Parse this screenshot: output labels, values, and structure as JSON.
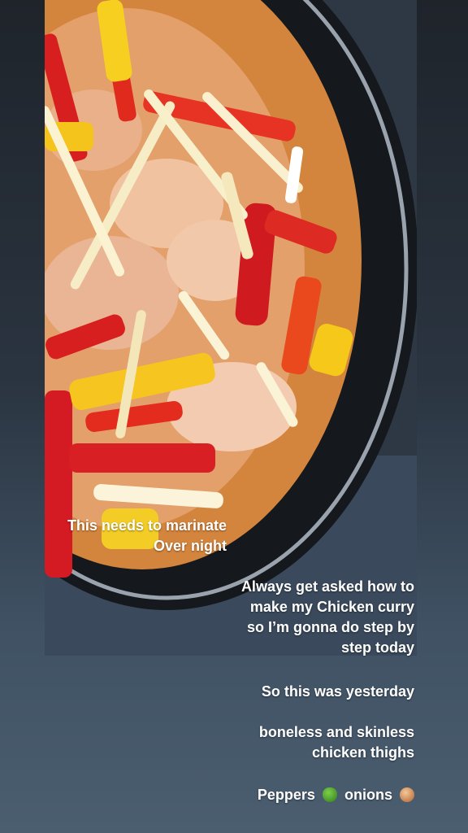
{
  "story": {
    "overlay_text": [
      "This needs to marinate",
      "Over night"
    ],
    "captions": [
      [
        "Always get asked how to",
        "make my Chicken curry",
        "so I’m gonna do step by",
        "step today"
      ],
      [
        "So this was yesterday"
      ],
      [
        "boneless and skinless",
        "chicken thighs"
      ]
    ],
    "ingredients": {
      "word1": "Peppers",
      "icon1": "green-pepper-emoji",
      "word2": "onions",
      "icon2": "onion-emoji"
    }
  }
}
